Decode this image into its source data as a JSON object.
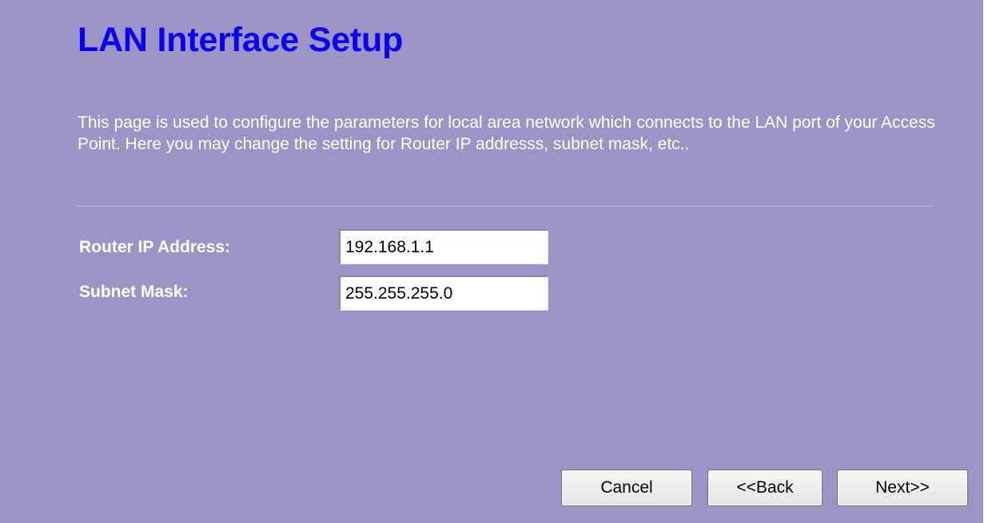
{
  "page": {
    "title": "LAN Interface Setup",
    "description": "This page is used to configure the parameters for local area network which connects to the LAN port of your Access Point. Here you may change the setting for Router IP addresss, subnet mask, etc.."
  },
  "form": {
    "router_ip": {
      "label": "Router IP Address:",
      "value": "192.168.1.1"
    },
    "subnet_mask": {
      "label": "Subnet Mask:",
      "value": "255.255.255.0"
    }
  },
  "buttons": {
    "cancel": "Cancel",
    "back": "<<Back",
    "next": "Next>>"
  },
  "colors": {
    "background": "#9c94c4",
    "title": "#0a00f0",
    "text": "#ffffff"
  }
}
